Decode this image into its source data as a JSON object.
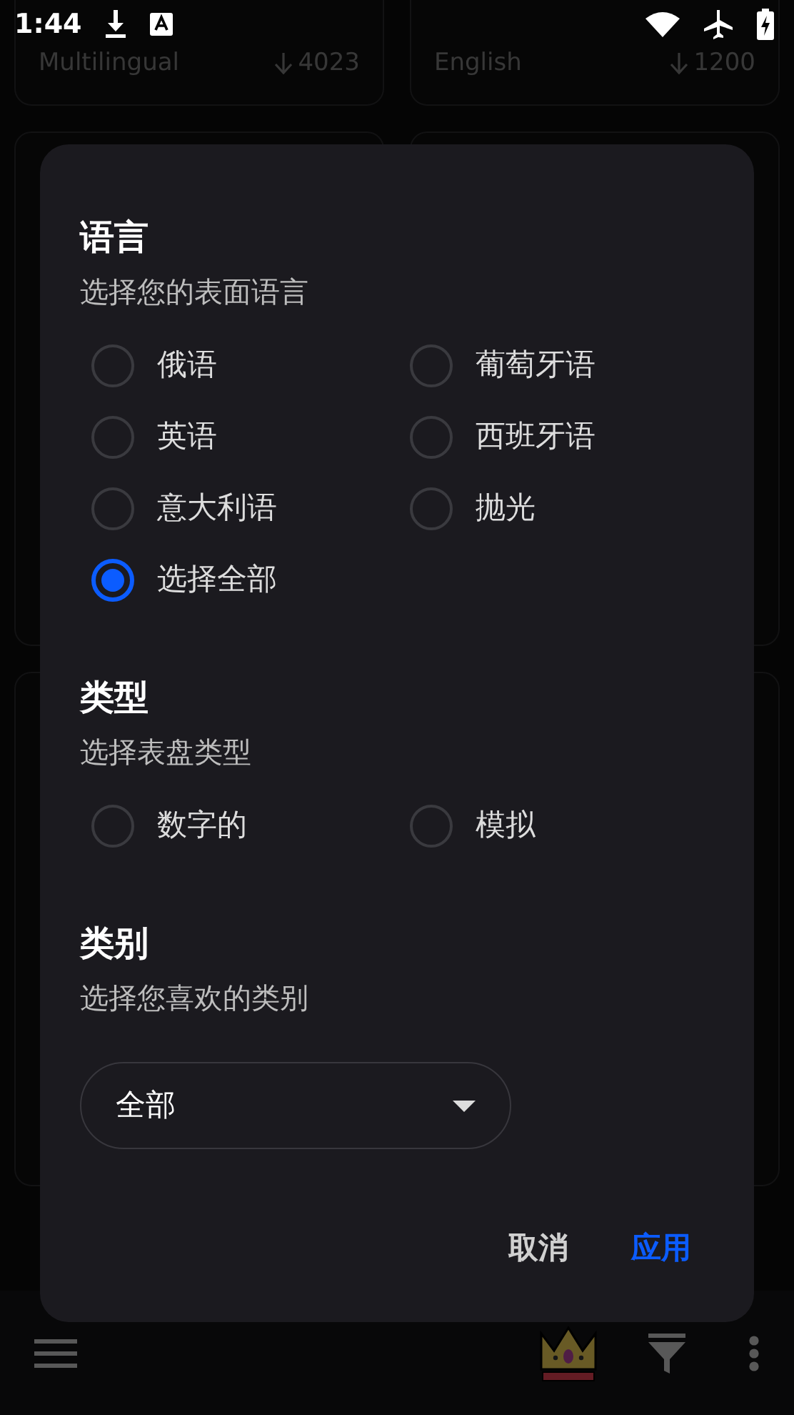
{
  "status_bar": {
    "time": "1:44"
  },
  "background_cards": [
    {
      "title": "Multilingual",
      "downloads": "4023"
    },
    {
      "title": "English",
      "downloads": "1200"
    }
  ],
  "dialog": {
    "sections": [
      {
        "title": "语言",
        "subtitle": "选择您的表面语言",
        "kind": "radios",
        "options": [
          {
            "label": "俄语",
            "selected": false
          },
          {
            "label": "葡萄牙语",
            "selected": false
          },
          {
            "label": "英语",
            "selected": false
          },
          {
            "label": "西班牙语",
            "selected": false
          },
          {
            "label": "意大利语",
            "selected": false
          },
          {
            "label": "抛光",
            "selected": false
          },
          {
            "label": "选择全部",
            "selected": true
          }
        ]
      },
      {
        "title": "类型",
        "subtitle": "选择表盘类型",
        "kind": "radios",
        "options": [
          {
            "label": "数字的",
            "selected": false
          },
          {
            "label": "模拟",
            "selected": false
          }
        ]
      },
      {
        "title": "类别",
        "subtitle": "选择您喜欢的类别",
        "kind": "dropdown",
        "value": "全部"
      }
    ],
    "buttons": [
      {
        "label": "取消",
        "kind": "cancel"
      },
      {
        "label": "应用",
        "kind": "apply"
      }
    ]
  }
}
